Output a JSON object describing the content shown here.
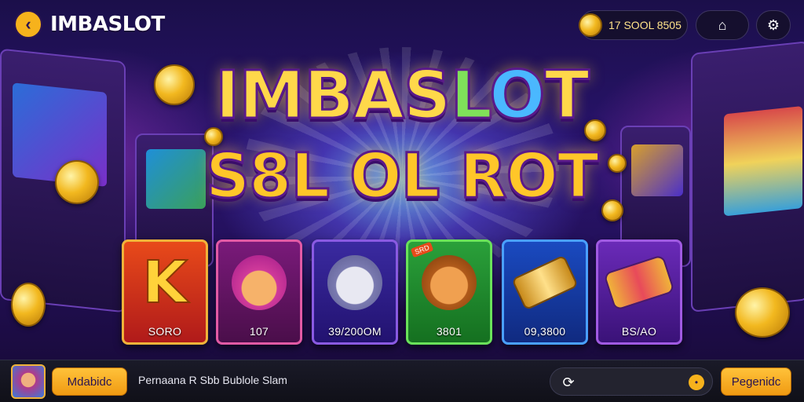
{
  "header": {
    "back_icon": "‹",
    "title": "IMBASLOT",
    "balance": "17 SOOL 8505",
    "account_icon": "⌂",
    "settings_icon": "⚙"
  },
  "hero": {
    "line1": [
      "IMBAS",
      "L",
      "O",
      "T"
    ],
    "line2": "S8L OL ROT"
  },
  "games": [
    {
      "label": "SORO",
      "art": "K",
      "badge": ""
    },
    {
      "label": "107",
      "art": "",
      "badge": ""
    },
    {
      "label": "39/200OM",
      "art": "",
      "badge": ""
    },
    {
      "label": "3801",
      "art": "",
      "badge": "SRD"
    },
    {
      "label": "09,3800",
      "art": "",
      "badge": ""
    },
    {
      "label": "BS/AO",
      "art": "",
      "badge": ""
    }
  ],
  "footer": {
    "primary_button": "Mdabidc",
    "ticker": "Pernaana R Sbb Bublole Slam",
    "search_icon": "⟳",
    "search_action_icon": "•",
    "end_button": "Pegenidc"
  }
}
